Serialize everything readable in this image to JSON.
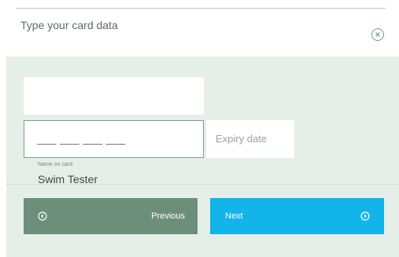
{
  "dialog": {
    "title": "Type your card data",
    "close_icon": "close-circle-icon"
  },
  "form": {
    "name_label": "Name on card",
    "name_value": "Swim Tester",
    "card_number_mask": "___ ___ ___ ___",
    "expiry_placeholder": "Expiry date"
  },
  "actions": {
    "previous_label": "Previous",
    "previous_icon": "arrow-left-circle-icon",
    "next_label": "Next",
    "next_icon": "arrow-right-circle-icon"
  },
  "colors": {
    "panel": "#e6eee8",
    "previous_button": "#6c8f7c",
    "next_button": "#12b4ea",
    "accent_green": "#7aa186"
  }
}
